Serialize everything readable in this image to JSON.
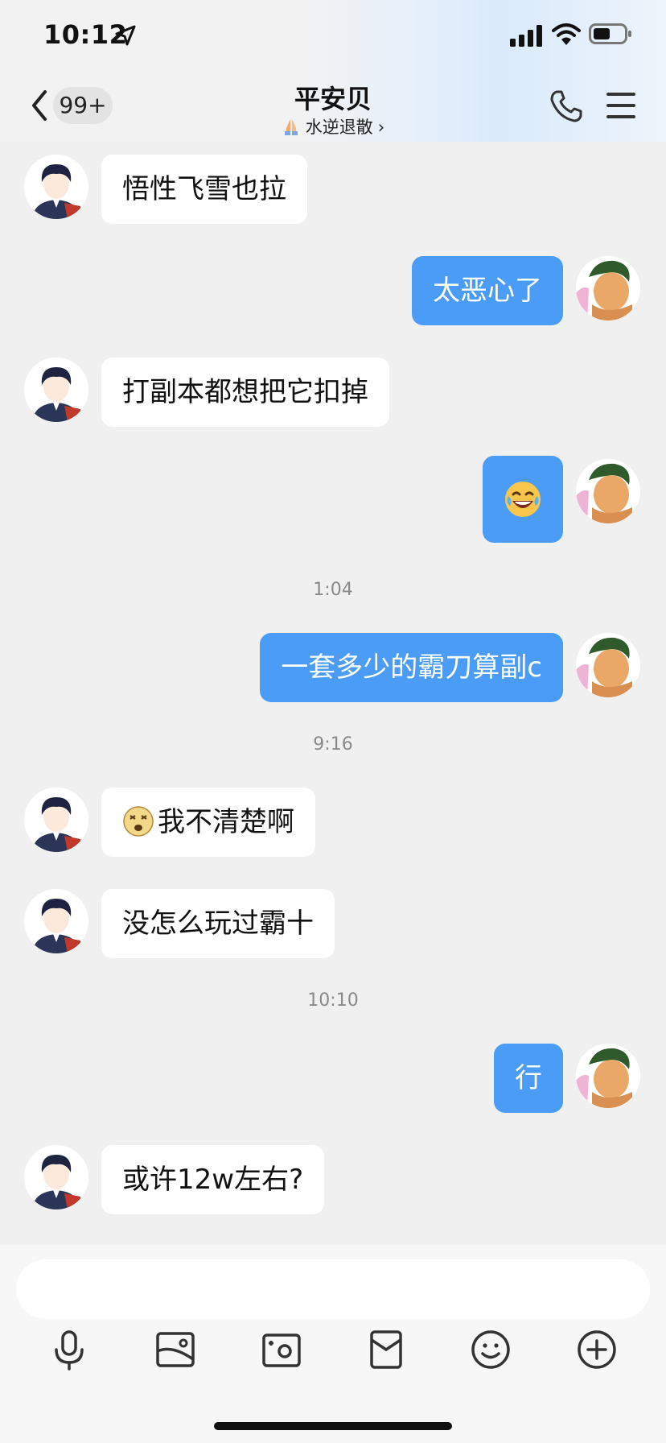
{
  "status_bar": {
    "time": "10:12"
  },
  "header": {
    "badge": "99+",
    "title": "平安贝",
    "subtitle": "水逆退散",
    "prayer_icon": "folded-hands-icon"
  },
  "messages": [
    {
      "side": "in",
      "text": "悟性飞雪也拉"
    },
    {
      "side": "out",
      "text": "太恶心了"
    },
    {
      "side": "in",
      "text": "打副本都想把它扣掉"
    },
    {
      "side": "out",
      "emoji": "laughing-tears-emoji-icon"
    },
    {
      "timestamp": "1:04"
    },
    {
      "side": "out",
      "text": "一套多少的霸刀算副c"
    },
    {
      "timestamp": "9:16"
    },
    {
      "side": "in",
      "text": "我不清楚啊",
      "leading_emoji": "dizzy-face-emoji-icon"
    },
    {
      "side": "in",
      "text": "没怎么玩过霸十"
    },
    {
      "timestamp": "10:10"
    },
    {
      "side": "out",
      "text": "行"
    },
    {
      "side": "in",
      "text": "或许12w左右?"
    }
  ],
  "toolbar": {
    "items": [
      "microphone-icon",
      "image-icon",
      "camera-icon",
      "red-packet-icon",
      "emoji-icon",
      "plus-icon"
    ]
  },
  "colors": {
    "outgoing_bubble": "#4a9cf7",
    "incoming_bubble": "#ffffff",
    "background": "#f0f0f0"
  }
}
